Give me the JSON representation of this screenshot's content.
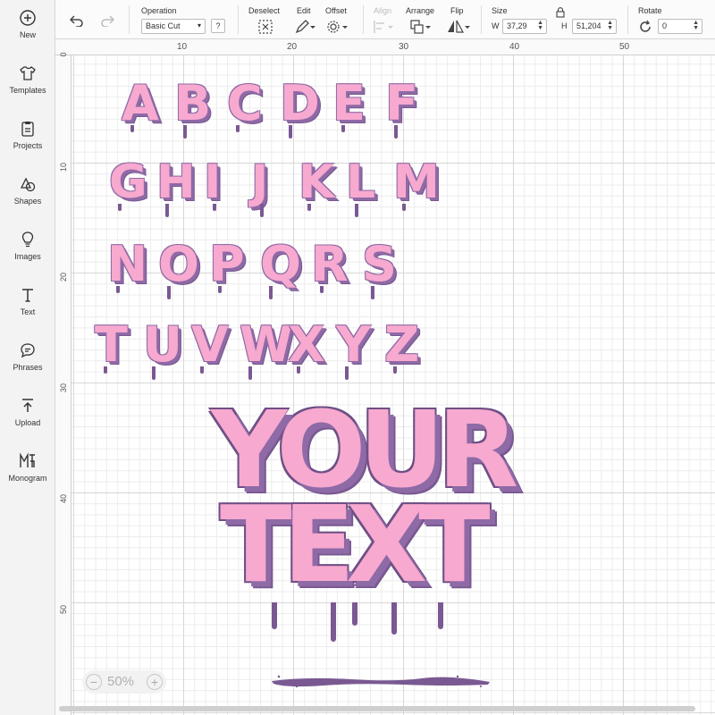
{
  "sidebar": {
    "items": [
      {
        "label": "New",
        "icon": "plus-circle-icon"
      },
      {
        "label": "Templates",
        "icon": "tshirt-icon"
      },
      {
        "label": "Projects",
        "icon": "clipboard-icon"
      },
      {
        "label": "Shapes",
        "icon": "shapes-icon"
      },
      {
        "label": "Images",
        "icon": "lightbulb-icon"
      },
      {
        "label": "Text",
        "icon": "text-icon"
      },
      {
        "label": "Phrases",
        "icon": "speech-bubble-icon"
      },
      {
        "label": "Upload",
        "icon": "upload-icon"
      },
      {
        "label": "Monogram",
        "icon": "monogram-icon"
      }
    ]
  },
  "toolbar": {
    "operation_title": "Operation",
    "operation_value": "Basic Cut",
    "help_label": "?",
    "deselect_label": "Deselect",
    "edit_label": "Edit",
    "offset_label": "Offset",
    "align_label": "Align",
    "arrange_label": "Arrange",
    "flip_label": "Flip",
    "size_title": "Size",
    "width_label": "W",
    "width_value": "37,29",
    "height_label": "H",
    "height_value": "51,204",
    "rotate_title": "Rotate",
    "rotate_value": "0"
  },
  "rulers": {
    "top": [
      "10",
      "20",
      "30",
      "40",
      "50"
    ],
    "left": [
      "0",
      "10",
      "20",
      "30",
      "40",
      "50"
    ]
  },
  "artwork": {
    "alphabet_rows": [
      "ABCDEF",
      "GHIJKLM",
      "NOPQRS",
      "TUVWXYZ"
    ],
    "headline_line1": "YOUR",
    "headline_line2": "TEXT"
  },
  "zoom": {
    "value": "50%",
    "minus": "−",
    "plus": "+"
  },
  "colors": {
    "letter_fill": "#f7a9cf",
    "letter_outline": "#8e6aa6",
    "drip": "#7a5992"
  }
}
